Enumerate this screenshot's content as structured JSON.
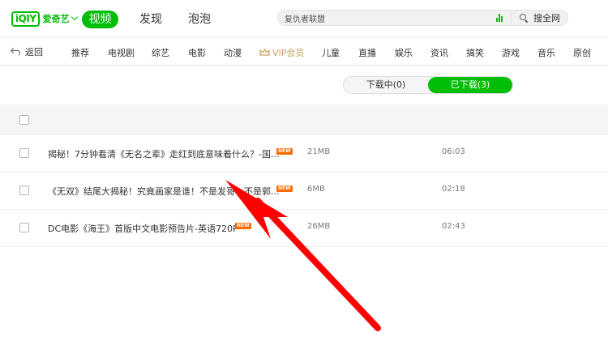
{
  "header": {
    "logo_mark": "iQIY",
    "logo_text": "爱奇艺",
    "nav": [
      {
        "label": "视频",
        "active": true
      },
      {
        "label": "发现",
        "active": false
      },
      {
        "label": "泡泡",
        "active": false
      }
    ],
    "search": {
      "value": "复仇者联盟",
      "button_label": "搜全网"
    }
  },
  "categories": {
    "back_label": "返回",
    "items": [
      "推荐",
      "电视剧",
      "综艺",
      "电影",
      "动漫",
      "VIP会员",
      "儿童",
      "直播",
      "娱乐",
      "资讯",
      "搞笑",
      "游戏",
      "音乐",
      "原创"
    ]
  },
  "download_tabs": {
    "downloading": "下载中(0)",
    "downloaded": "已下载(3)",
    "active": "downloaded"
  },
  "downloads": [
    {
      "title": "揭秘！7分钟看清《无名之辈》走红到底意味着什么？-国...",
      "badge": "NEW",
      "size": "21MB",
      "duration": "06:03"
    },
    {
      "title": "《无双》结尾大揭秘！究竟画家是谁！不是发哥！不是郭...",
      "badge": "NEW",
      "size": "6MB",
      "duration": "02:18"
    },
    {
      "title": "DC电影《海王》首版中文电影预告片-英语720P",
      "badge": "NEW",
      "size": "26MB",
      "duration": "02:43"
    }
  ],
  "colors": {
    "brand": "#00be06",
    "vip": "#c9a25d",
    "badge": "#ff6a00",
    "annotation_arrow": "#ff0000"
  }
}
